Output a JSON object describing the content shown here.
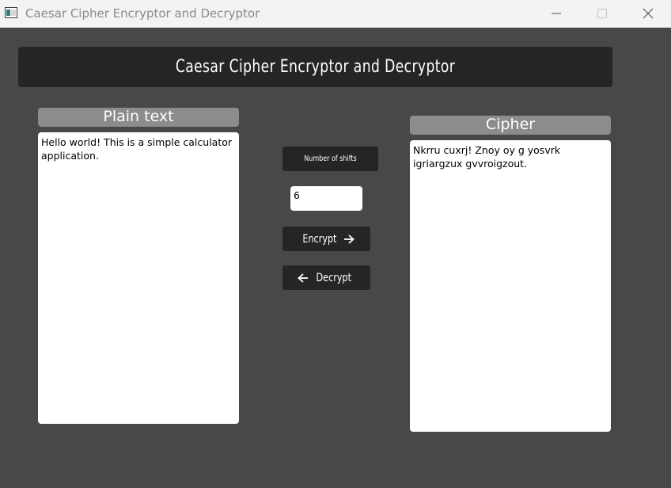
{
  "window": {
    "title": "Caesar Cipher Encryptor and Decryptor"
  },
  "header": {
    "title": "Caesar Cipher Encryptor and Decryptor"
  },
  "plain_panel": {
    "label": "Plain text",
    "value": "Hello world! This is a simple calculator application."
  },
  "cipher_panel": {
    "label": "Cipher",
    "value": "Nkrru cuxrj! Znoy oy g yosvrk igriargzux gvvroigzout."
  },
  "controls": {
    "shifts_label": "Number of shifts",
    "shifts_value": "6",
    "encrypt_label": "Encrypt",
    "decrypt_label": "Decrypt"
  },
  "icons": {
    "encrypt": "arrow-right-icon",
    "decrypt": "arrow-left-icon"
  },
  "colors": {
    "background": "#484848",
    "dark_bar": "#252525",
    "label_gray": "#8c8c8c"
  }
}
